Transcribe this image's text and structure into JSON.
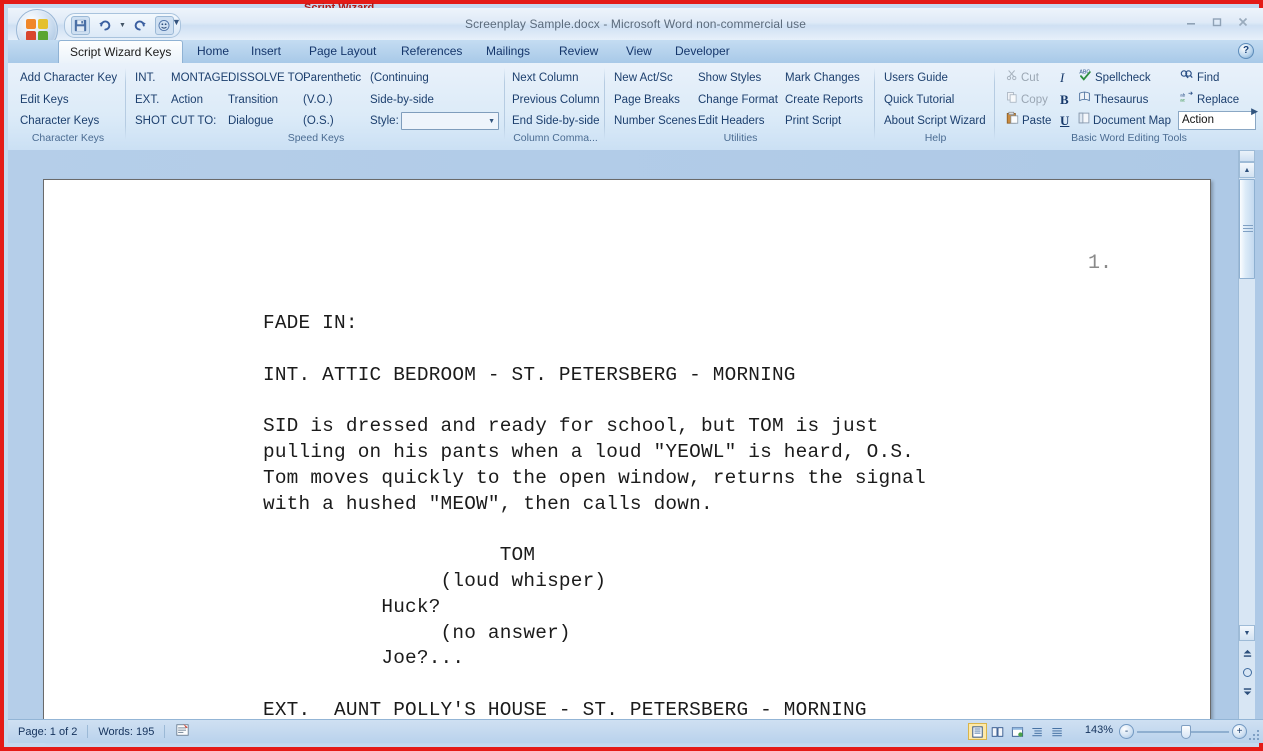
{
  "window": {
    "title": "Screenplay Sample.docx - Microsoft Word non-commercial use",
    "clipped_top_text": "Script Wizard",
    "controls": {
      "minimize": "Minimize",
      "restore": "Restore Down",
      "close": "Close"
    },
    "help_button": "?"
  },
  "quick_access": {
    "items": [
      {
        "name": "save-icon",
        "label": "Save"
      },
      {
        "name": "undo-icon",
        "label": "Undo"
      },
      {
        "name": "undo-dropdown-icon",
        "label": "Undo History"
      },
      {
        "name": "redo-icon",
        "label": "Redo"
      },
      {
        "name": "script-wizard-icon",
        "label": "Script Wizard"
      }
    ],
    "customize_label": "Customize Quick Access Toolbar"
  },
  "tabs": [
    {
      "label": "Script Wizard Keys",
      "active": true
    },
    {
      "label": "Home",
      "active": false
    },
    {
      "label": "Insert",
      "active": false
    },
    {
      "label": "Page Layout",
      "active": false
    },
    {
      "label": "References",
      "active": false
    },
    {
      "label": "Mailings",
      "active": false
    },
    {
      "label": "Review",
      "active": false
    },
    {
      "label": "View",
      "active": false
    },
    {
      "label": "Developer",
      "active": false
    }
  ],
  "ribbon": {
    "groups": [
      {
        "name": "character-keys",
        "label": "Character Keys",
        "buttons": [
          "Add Character Key",
          "Edit Keys",
          "Character Keys"
        ]
      },
      {
        "name": "speed-keys",
        "label": "Speed Keys",
        "col1": [
          "INT.",
          "EXT.",
          "SHOT"
        ],
        "col2": [
          "MONTAGE",
          "Action",
          "CUT TO:"
        ],
        "col3": [
          "DISSOLVE TO:",
          "Transition",
          "Dialogue"
        ],
        "col4": [
          "Parenthetic",
          "(V.O.)",
          "(O.S.)"
        ],
        "col5": [
          "(Continuing",
          "Side-by-side"
        ],
        "style_label": "Style:",
        "style_value": ""
      },
      {
        "name": "column-commands",
        "label": "Column Comma...",
        "buttons": [
          "Next Column",
          "Previous Column",
          "End Side-by-side"
        ]
      },
      {
        "name": "utilities",
        "label": "Utilities",
        "col1": [
          "New Act/Sc",
          "Page Breaks",
          "Number Scenes"
        ],
        "col2": [
          "Show Styles",
          "Change Format",
          "Edit Headers"
        ],
        "col3": [
          "Mark Changes",
          "Create Reports",
          "Print Script"
        ]
      },
      {
        "name": "help",
        "label": "Help",
        "buttons": [
          "Users Guide",
          "Quick Tutorial",
          "About Script Wizard"
        ]
      },
      {
        "name": "basic-word-editing-tools",
        "label": "Basic Word Editing Tools",
        "clipboard": [
          {
            "label": "Cut",
            "icon": "scissors-icon",
            "disabled": true
          },
          {
            "label": "Copy",
            "icon": "copy-icon",
            "disabled": true
          },
          {
            "label": "Paste",
            "icon": "paste-icon",
            "disabled": false
          }
        ],
        "format": [
          {
            "label": "I",
            "icon": "italic-icon"
          },
          {
            "label": "B",
            "icon": "bold-icon"
          },
          {
            "label": "U",
            "icon": "underline-icon"
          }
        ],
        "tools": [
          {
            "label": "Spellcheck",
            "icon": "spellcheck-icon"
          },
          {
            "label": "Thesaurus",
            "icon": "thesaurus-icon"
          },
          {
            "label": "Document Map",
            "icon": "document-map-icon"
          }
        ],
        "findgroup": [
          {
            "label": "Find",
            "icon": "find-icon"
          },
          {
            "label": "Replace",
            "icon": "replace-icon"
          }
        ],
        "style_textbox_value": "Action"
      }
    ]
  },
  "document": {
    "page_number": "1.",
    "body": "FADE IN:\n\nINT. ATTIC BEDROOM - ST. PETERSBERG - MORNING\n\nSID is dressed and ready for school, but TOM is just\npulling on his pants when a loud \"YEOWL\" is heard, O.S.\nTom moves quickly to the open window, returns the signal\nwith a hushed \"MEOW\", then calls down.\n\n                    TOM\n               (loud whisper)\n          Huck?\n               (no answer)\n          Joe?...\n\nEXT.  AUNT POLLY'S HOUSE - ST. PETERSBERG - MORNING"
  },
  "status_bar": {
    "page": "Page: 1 of 2",
    "words": "Words: 195",
    "proofing_icon": "proofing-errors-icon",
    "views": [
      {
        "name": "print-layout-view",
        "active": true
      },
      {
        "name": "full-screen-reading-view",
        "active": false
      },
      {
        "name": "web-layout-view",
        "active": false
      },
      {
        "name": "outline-view",
        "active": false
      },
      {
        "name": "draft-view",
        "active": false
      }
    ],
    "zoom_level": "143%",
    "zoom_out_label": "-",
    "zoom_in_label": "+"
  }
}
